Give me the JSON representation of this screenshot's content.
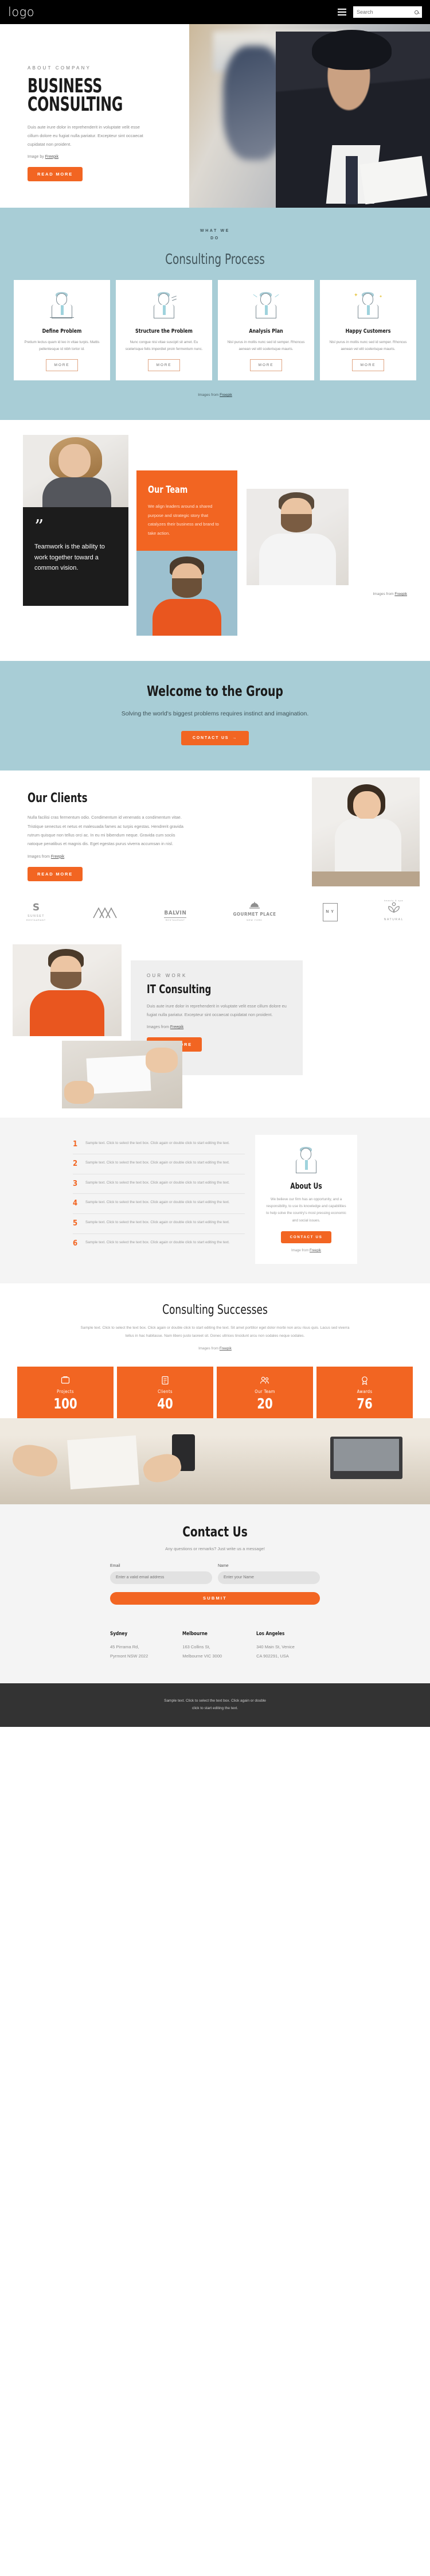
{
  "header": {
    "logo": "logo",
    "menu_icon": "hamburger-menu-icon",
    "search_placeholder": "Search",
    "search_value": ""
  },
  "hero": {
    "eyebrow": "ABOUT COMPANY",
    "title_line1": "BUSINESS",
    "title_line2": "CONSULTING",
    "paragraph": "Duis aute irure dolor in reprehenderit in voluptate velit esse cillum dolore eu fugiat nulla pariatur. Excepteur sint occaecat cupidatat non proident.",
    "credit_prefix": "Image by ",
    "credit_link": "Freepik",
    "button": "READ MORE"
  },
  "process": {
    "eyebrow_line1": "WHAT WE",
    "eyebrow_line2": "DO",
    "title": "Consulting Process",
    "credit_prefix": "Images from ",
    "credit_link": "Freepik",
    "cards": [
      {
        "title": "Define Problem",
        "text": "Pretium lectus quam id leo in vitae turpis. Mattis pellentesque id nibh tortor id.",
        "button": "MORE"
      },
      {
        "title": "Structure the Problem",
        "text": "Nunc congue nisi vitae suscipit sit amet. Eu scelerisque felis imperdiet proin fermentum nunc.",
        "button": "MORE"
      },
      {
        "title": "Analysis Plan",
        "text": "Nisl purus in mollis nunc sed id semper. Rhoncus aenean vel elit scelerisque mauris.",
        "button": "MORE"
      },
      {
        "title": "Happy Customers",
        "text": "Nisl purus in mollis nunc sed id semper. Rhoncus aenean vel elit scelerisque mauris.",
        "button": "MORE"
      }
    ]
  },
  "team": {
    "quote_mark": "”",
    "quote": "Teamwork is the ability to work together toward a common vision.",
    "title": "Our Team",
    "text": "We align leaders around a shared purpose and strategic story that catalyzes their business and brand to take action.",
    "credit_prefix": "Images from ",
    "credit_link": "Freepik"
  },
  "welcome": {
    "title": "Welcome to the Group",
    "subtitle": "Solving the world's biggest problems requires instinct and imagination.",
    "button": "CONTACT US",
    "button_arrow": "→"
  },
  "clients": {
    "title": "Our Clients",
    "paragraph": "Nulla facilisi cras fermentum odio. Condimentum id venenatis a condimentum vitae. Tristique senectus et netus et malesuada fames ac turpis egestas. Hendrerit gravida rutrum quisque non tellus orci ac. In eu mi bibendum neque. Gravida cum sociis natoque penatibus et magnis dis. Eget egestas purus viverra accumsan in nisl.",
    "credit_prefix": "Images from ",
    "credit_link": "Freepik",
    "button": "READ MORE",
    "logos": [
      {
        "mark": "S",
        "name": "SUNSET",
        "sub": "RESTAURANT"
      },
      {
        "mark": "mountain-icon",
        "name": "",
        "sub": ""
      },
      {
        "mark": "BALVIN",
        "name": "RESTAURANT",
        "sub": ""
      },
      {
        "mark": "dome-icon",
        "name": "GOURMET PLACE",
        "sub": "NEW YORK"
      },
      {
        "mark": "N Y",
        "name": "",
        "sub": ""
      },
      {
        "mark": "leaf-icon",
        "name": "NATURAL",
        "sub": "beauty & spa"
      }
    ]
  },
  "it_consulting": {
    "eyebrow": "OUR WORK",
    "title": "IT Consulting",
    "paragraph": "Duis aute irure dolor in reprehenderit in voluptate velit esse cillum dolore eu fugiat nulla pariatur. Excepteur sint occaecat cupidatat non proident.",
    "credit_prefix": "Images from ",
    "credit_link": "Freepik",
    "button": "READ MORE"
  },
  "numbered_list": {
    "items": [
      {
        "num": "1",
        "text": "Sample text. Click to select the text box. Click again or double click to start editing the text."
      },
      {
        "num": "2",
        "text": "Sample text. Click to select the text box. Click again or double click to start editing the text."
      },
      {
        "num": "3",
        "text": "Sample text. Click to select the text box. Click again or double click to start editing the text."
      },
      {
        "num": "4",
        "text": "Sample text. Click to select the text box. Click again or double click to start editing the text."
      },
      {
        "num": "5",
        "text": "Sample text. Click to select the text box. Click again or double click to start editing the text."
      },
      {
        "num": "6",
        "text": "Sample text. Click to select the text box. Click again or double click to start editing the text."
      }
    ],
    "about": {
      "title": "About Us",
      "text": "We believe our firm has an opportunity, and a responsibility, to use its knowledge and capabilities to help solve the country's most pressing economic and social issues.",
      "button": "CONTACT US",
      "credit_prefix": "Image from ",
      "credit_link": "Freepik"
    }
  },
  "successes": {
    "title": "Consulting Successes",
    "paragraph": "Sample text. Click to select the text box. Click again or double click to start editing the text. Sit amet porttitor eget dolor morbi non arcu risus quis. Lacus sed viverra tellus in hac habitasse. Nam libero justo laoreet sit. Donec ultrices tincidunt arcu non sodales neque sodales.",
    "credit_prefix": "Images from ",
    "credit_link": "Freepik",
    "stats": [
      {
        "icon": "projects-icon",
        "label": "Projects",
        "value": "100"
      },
      {
        "icon": "clients-icon",
        "label": "Clients",
        "value": "40"
      },
      {
        "icon": "team-icon",
        "label": "Our Team",
        "value": "20"
      },
      {
        "icon": "awards-icon",
        "label": "Awards",
        "value": "76"
      }
    ]
  },
  "contact": {
    "title": "Contact Us",
    "subtitle": "Any questions or remarks? Just write us a message!",
    "email_label": "Email",
    "email_placeholder": "Enter a valid email address",
    "name_label": "Name",
    "name_placeholder": "Enter your Name",
    "submit": "SUBMIT",
    "offices": [
      {
        "city": "Sydney",
        "line1": "45 Pirrama Rd,",
        "line2": "Pyrmont NSW 2022"
      },
      {
        "city": "Melbourne",
        "line1": "163 Collins St,",
        "line2": "Melbourne VIC 3000"
      },
      {
        "city": "Los Angeles",
        "line1": "340 Main St, Venice",
        "line2": "CA 902291, USA"
      }
    ]
  },
  "footer": {
    "line1": "Sample text. Click to select the text box. Click again or double",
    "line2": "click to start editing the text."
  },
  "colors": {
    "accent": "#f26522",
    "teal": "#a8cdd6",
    "dark": "#1c1c1c"
  }
}
